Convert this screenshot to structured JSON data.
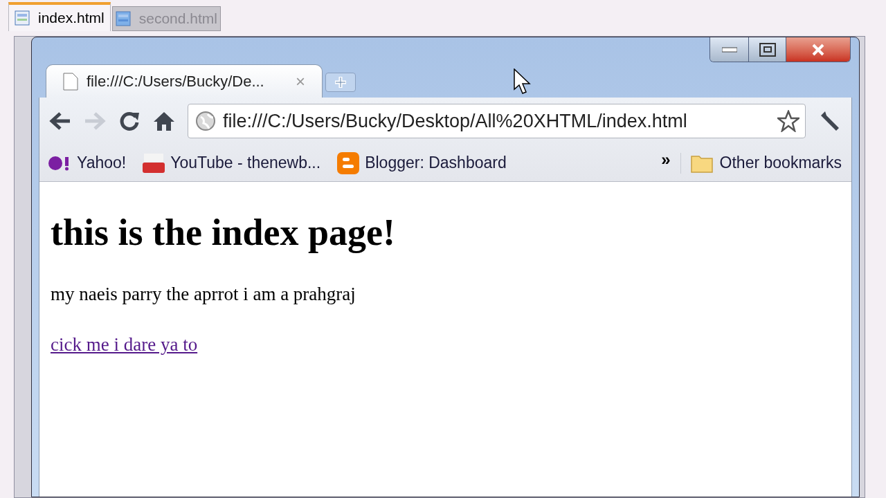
{
  "editor_tabs": [
    {
      "label": "index.html",
      "selected": true
    },
    {
      "label": "second.html",
      "selected": false
    }
  ],
  "browser": {
    "tab_title": "file:///C:/Users/Bucky/De...",
    "close_glyph": "×",
    "forward_disabled": true,
    "url": "file:///C:/Users/Bucky/Desktop/All%20XHTML/index.html",
    "bookmarks": [
      {
        "label": "Yahoo!",
        "kind": "yahoo"
      },
      {
        "label": "YouTube - thenewb...",
        "kind": "youtube"
      },
      {
        "label": "Blogger: Dashboard",
        "kind": "blogger"
      }
    ],
    "overflow_glyph": "»",
    "other_bookmarks": "Other bookmarks"
  },
  "page": {
    "heading": "this is the index page!",
    "paragraph": "my naeis parry the aprrot i am a prahgraj",
    "link": "cick me i dare ya to"
  }
}
